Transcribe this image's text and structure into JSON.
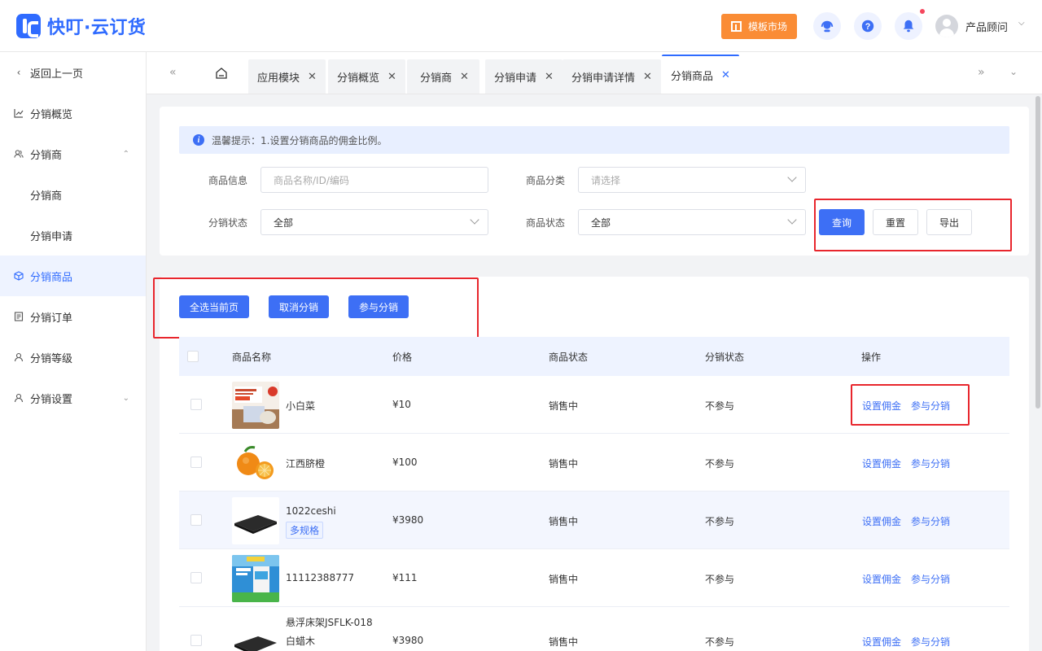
{
  "app": {
    "logo_text": "快叮·云订货",
    "template_market": "模板市场",
    "user_name": "产品顾问"
  },
  "sidebar": {
    "back": "返回上一页",
    "items": [
      {
        "label": "分销概览"
      },
      {
        "label": "分销商"
      },
      {
        "label": "分销商"
      },
      {
        "label": "分销申请"
      },
      {
        "label": "分销商品"
      },
      {
        "label": "分销订单"
      },
      {
        "label": "分销等级"
      },
      {
        "label": "分销设置"
      }
    ]
  },
  "tabs": [
    {
      "label": "应用模块"
    },
    {
      "label": "分销概览"
    },
    {
      "label": "分销商"
    },
    {
      "label": "分销申请"
    },
    {
      "label": "分销申请详情"
    },
    {
      "label": "分销商品"
    }
  ],
  "tip": "温馨提示：1.设置分销商品的佣金比例。",
  "filters": {
    "product_info_label": "商品信息",
    "product_info_placeholder": "商品名称/ID/编码",
    "category_label": "商品分类",
    "category_placeholder": "请选择",
    "dist_status_label": "分销状态",
    "dist_status_value": "全部",
    "product_status_label": "商品状态",
    "product_status_value": "全部",
    "query": "查询",
    "reset": "重置",
    "export": "导出"
  },
  "batch": {
    "select_page": "全选当前页",
    "cancel_dist": "取消分销",
    "join_dist": "参与分销"
  },
  "table": {
    "headers": [
      "商品名称",
      "价格",
      "商品状态",
      "分销状态",
      "操作"
    ],
    "rows": [
      {
        "name": "小白菜",
        "price": "¥10",
        "status": "销售中",
        "dist": "不参与",
        "spec": ""
      },
      {
        "name": "江西脐橙",
        "price": "¥100",
        "status": "销售中",
        "dist": "不参与",
        "spec": ""
      },
      {
        "name": "1022ceshi",
        "price": "¥3980",
        "status": "销售中",
        "dist": "不参与",
        "spec": "多规格"
      },
      {
        "name": "11112388777",
        "price": "¥111",
        "status": "销售中",
        "dist": "不参与",
        "spec": ""
      },
      {
        "name": "悬浮床架JSFLK-018",
        "name2": "白蜡木",
        "price": "¥3980",
        "status": "销售中",
        "dist": "不参与",
        "spec": ""
      }
    ],
    "action_commission": "设置佣金",
    "action_join": "参与分销"
  },
  "colors": {
    "primary": "#3d6ff5",
    "orange": "#fa8c35",
    "highlight_box": "#e8262d"
  }
}
